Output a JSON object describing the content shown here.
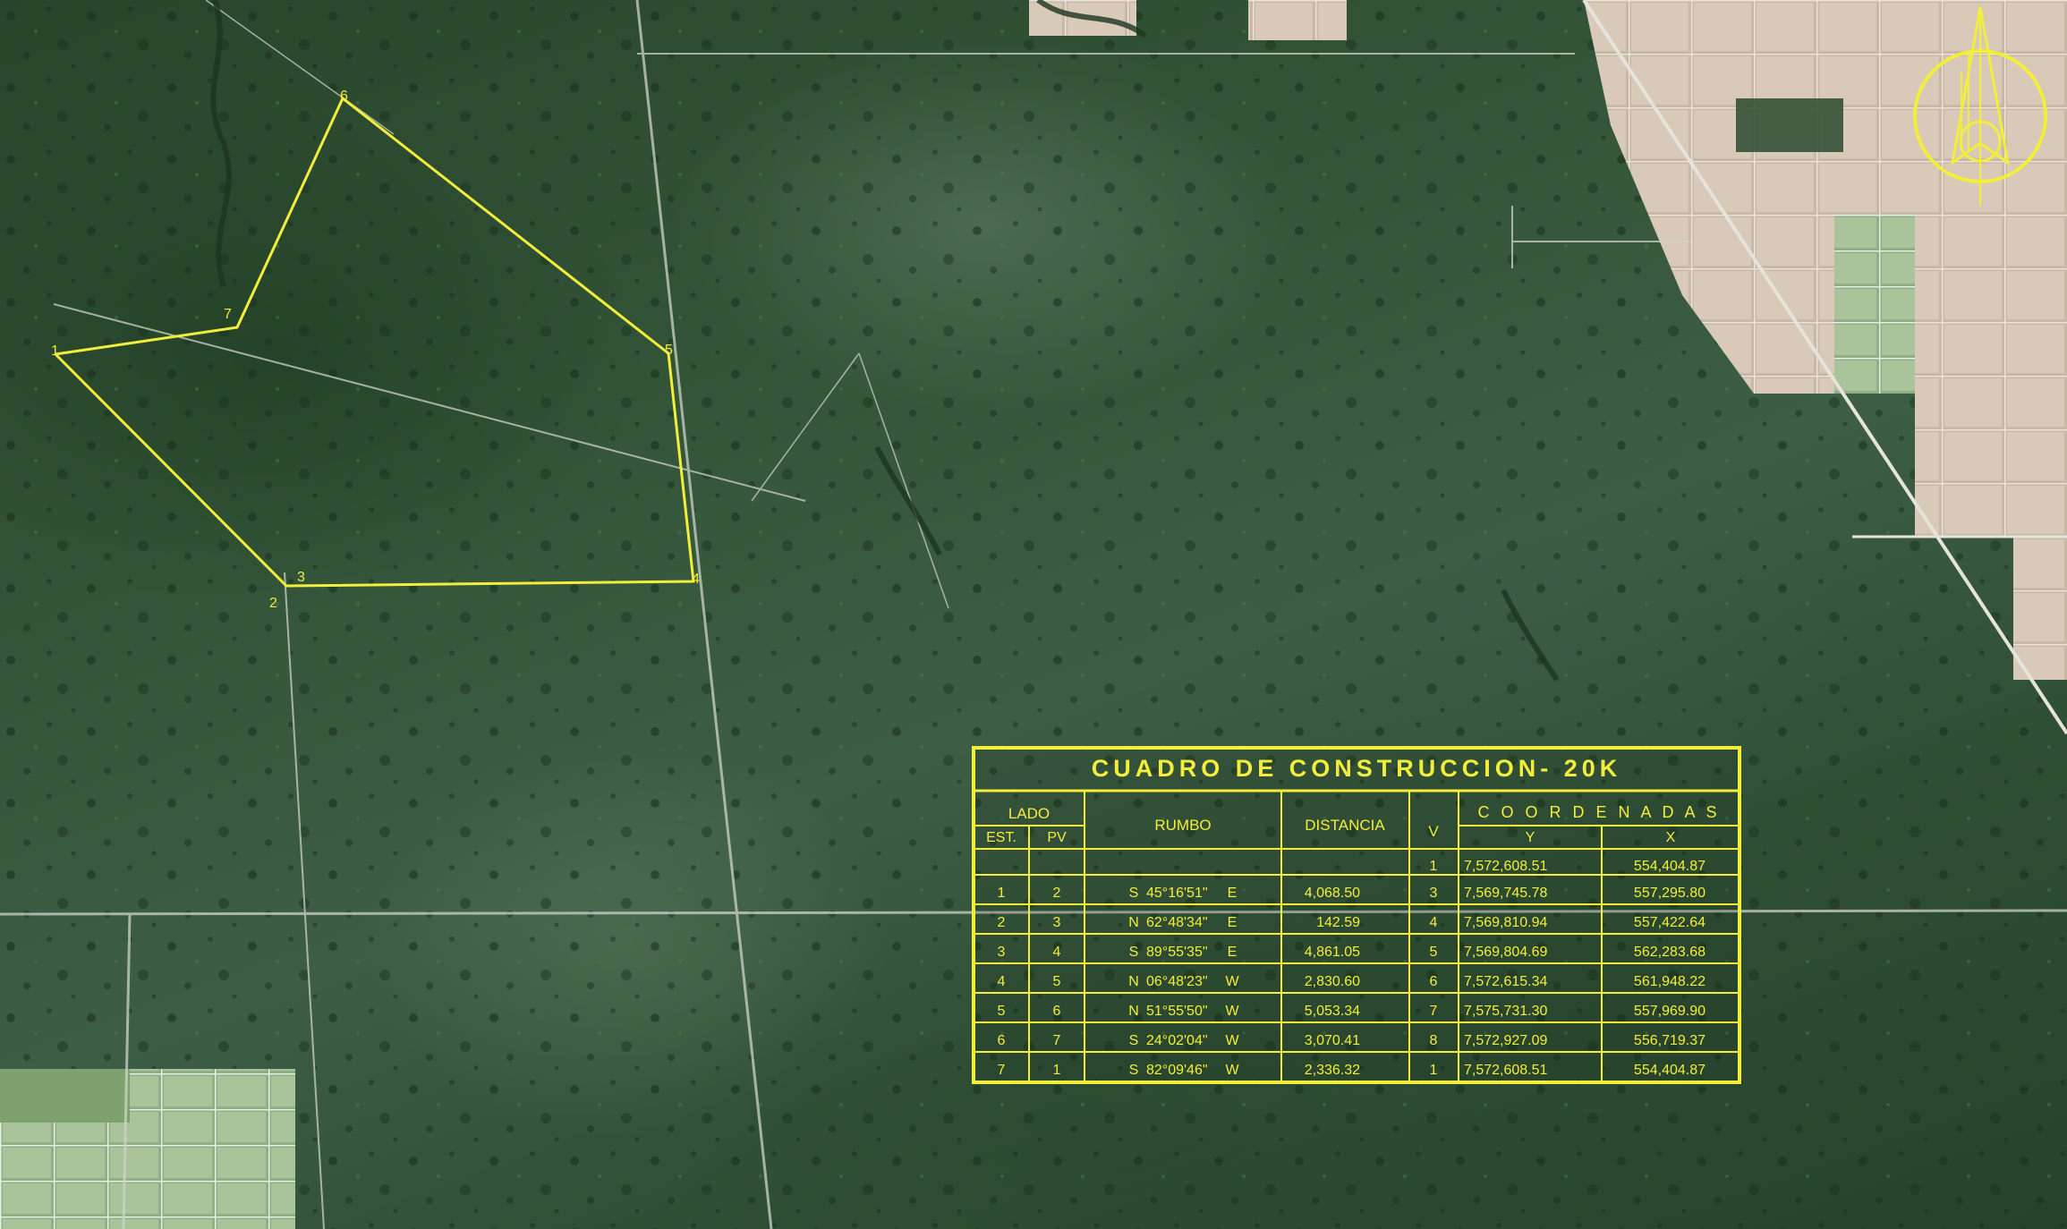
{
  "polygon_labels": [
    "1",
    "2",
    "3",
    "4",
    "5",
    "6",
    "7"
  ],
  "table": {
    "title": "CUADRO DE CONSTRUCCION- 20K",
    "headers": {
      "lado": "LADO",
      "est": "EST.",
      "pv": "PV",
      "rumbo": "RUMBO",
      "distancia": "DISTANCIA",
      "v": "V",
      "coordenadas": "C O O R D E N A D A S",
      "y": "Y",
      "x": "X"
    },
    "first_row": {
      "v": "1",
      "y": "7,572,608.51",
      "x": "554,404.87"
    },
    "rows": [
      {
        "est": "1",
        "pv": "2",
        "ns": "S",
        "angle": "45°16'51\"",
        "ew": "E",
        "dist": "4,068.50",
        "v": "3",
        "y": "7,569,745.78",
        "x": "557,295.80"
      },
      {
        "est": "2",
        "pv": "3",
        "ns": "N",
        "angle": "62°48'34\"",
        "ew": "E",
        "dist": "142.59",
        "v": "4",
        "y": "7,569,810.94",
        "x": "557,422.64"
      },
      {
        "est": "3",
        "pv": "4",
        "ns": "S",
        "angle": "89°55'35\"",
        "ew": "E",
        "dist": "4,861.05",
        "v": "5",
        "y": "7,569,804.69",
        "x": "562,283.68"
      },
      {
        "est": "4",
        "pv": "5",
        "ns": "N",
        "angle": "06°48'23\"",
        "ew": "W",
        "dist": "2,830.60",
        "v": "6",
        "y": "7,572,615.34",
        "x": "561,948.22"
      },
      {
        "est": "5",
        "pv": "6",
        "ns": "N",
        "angle": "51°55'50\"",
        "ew": "W",
        "dist": "5,053.34",
        "v": "7",
        "y": "7,575,731.30",
        "x": "557,969.90"
      },
      {
        "est": "6",
        "pv": "7",
        "ns": "S",
        "angle": "24°02'04\"",
        "ew": "W",
        "dist": "3,070.41",
        "v": "8",
        "y": "7,572,927.09",
        "x": "556,719.37"
      },
      {
        "est": "7",
        "pv": "1",
        "ns": "S",
        "angle": "82°09'46\"",
        "ew": "W",
        "dist": "2,336.32",
        "v": "1",
        "y": "7,572,608.51",
        "x": "554,404.87"
      }
    ]
  },
  "colors": {
    "annotation": "#f3ee3a",
    "vegetation": "#2f4f35",
    "fields": "#c9b9a8"
  },
  "icons": {
    "north_arrow": "north-arrow-icon"
  }
}
